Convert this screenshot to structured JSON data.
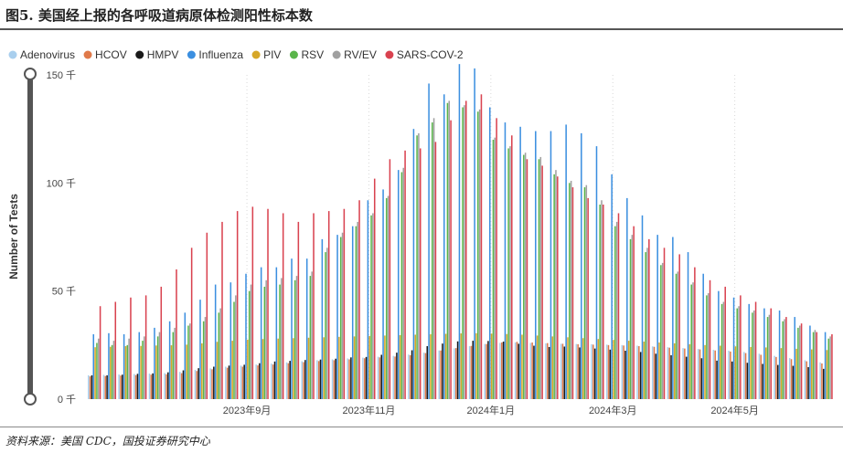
{
  "figure": {
    "title": "图5. 美国经上报的各呼吸道病原体检测阳性标本数",
    "source": "资料来源：美国 CDC，国投证券研究中心"
  },
  "chart_data": {
    "type": "bar",
    "ylabel": "Number of Tests",
    "xlabel": "",
    "ylim": [
      0,
      150000
    ],
    "y_ticks": [
      0,
      50000,
      100000,
      150000
    ],
    "y_tick_labels": [
      "0 千",
      "50 千",
      "100 千",
      "150 千"
    ],
    "x_tick_labels": [
      "2023年9月",
      "2023年11月",
      "2024年1月",
      "2024年3月",
      "2024年5月"
    ],
    "x_tick_category_index": [
      10,
      18,
      26,
      34,
      42
    ],
    "grid": "vertical dotted",
    "legend_position": "top-left",
    "categories_note": "weekly periods, unlabeled",
    "categories": [
      "W01",
      "W02",
      "W03",
      "W04",
      "W05",
      "W06",
      "W07",
      "W08",
      "W09",
      "W10",
      "W11",
      "W12",
      "W13",
      "W14",
      "W15",
      "W16",
      "W17",
      "W18",
      "W19",
      "W20",
      "W21",
      "W22",
      "W23",
      "W24",
      "W25",
      "W26",
      "W27",
      "W28",
      "W29",
      "W30",
      "W31",
      "W32",
      "W33",
      "W34",
      "W35",
      "W36",
      "W37",
      "W38",
      "W39",
      "W40",
      "W41",
      "W42",
      "W43",
      "W44",
      "W45",
      "W46",
      "W47",
      "W48",
      "W49"
    ],
    "series": [
      {
        "name": "Adenovirus",
        "color": "#a9cfee",
        "values": [
          11000,
          11200,
          11400,
          11600,
          11800,
          12000,
          12600,
          13500,
          14200,
          15000,
          15500,
          16000,
          16400,
          17000,
          17500,
          18000,
          18400,
          18800,
          19200,
          19600,
          20000,
          20600,
          21500,
          22500,
          23500,
          24500,
          25500,
          26000,
          26200,
          26000,
          25800,
          25600,
          25500,
          25400,
          25200,
          25000,
          24700,
          24400,
          24000,
          23600,
          23200,
          22800,
          22400,
          21800,
          21000,
          20000,
          19000,
          18000,
          17000
        ]
      },
      {
        "name": "HCOV",
        "color": "#e07a4a",
        "values": [
          10500,
          10700,
          10900,
          11100,
          11300,
          11500,
          12000,
          13000,
          13800,
          14500,
          15000,
          15600,
          16000,
          16600,
          17100,
          17600,
          18000,
          18400,
          18900,
          19300,
          19700,
          20300,
          21300,
          22500,
          23600,
          24600,
          25500,
          26200,
          26500,
          26200,
          25900,
          25600,
          25400,
          25200,
          25000,
          24800,
          24500,
          24200,
          23800,
          23400,
          23000,
          22500,
          22000,
          21300,
          20500,
          19500,
          18500,
          17500,
          16500
        ]
      },
      {
        "name": "HMPV",
        "color": "#1a1a1a",
        "values": [
          11000,
          11000,
          11300,
          11700,
          11900,
          12400,
          13300,
          14300,
          15000,
          15500,
          15900,
          16600,
          17400,
          17700,
          18100,
          18300,
          18700,
          19300,
          19500,
          20500,
          21500,
          22600,
          24500,
          25700,
          26700,
          27000,
          26900,
          26600,
          25600,
          24700,
          24100,
          24300,
          23900,
          23400,
          22900,
          22400,
          21800,
          21000,
          20300,
          19600,
          18900,
          17800,
          17400,
          16800,
          16300,
          15800,
          15400,
          14800,
          14000
        ]
      },
      {
        "name": "Influenza",
        "color": "#3b8fe0",
        "values": [
          30000,
          30500,
          30000,
          31000,
          33000,
          36000,
          40000,
          46000,
          53000,
          54000,
          58000,
          61000,
          61000,
          65000,
          65000,
          74000,
          76000,
          80000,
          92000,
          97000,
          106000,
          125000,
          146000,
          141000,
          155000,
          153000,
          135000,
          128000,
          126000,
          124000,
          124000,
          127000,
          123000,
          117000,
          104000,
          93000,
          85000,
          76000,
          75000,
          68000,
          58000,
          50000,
          47000,
          44000,
          42000,
          41000,
          38000,
          34000,
          31000
        ]
      },
      {
        "name": "PIV",
        "color": "#d6a728",
        "values": [
          24000,
          24200,
          24500,
          24600,
          24800,
          24900,
          25200,
          25800,
          26500,
          27000,
          27500,
          27800,
          28000,
          28200,
          28400,
          28600,
          28800,
          29000,
          29200,
          29400,
          29600,
          29800,
          30000,
          30200,
          30400,
          30500,
          30300,
          30100,
          29800,
          29400,
          29000,
          28600,
          28200,
          27800,
          27400,
          27000,
          26600,
          26200,
          25800,
          25400,
          25000,
          24700,
          24400,
          24100,
          23900,
          23600,
          23300,
          23000,
          22700
        ]
      },
      {
        "name": "RSV",
        "color": "#5ab54b",
        "values": [
          26000,
          25000,
          25000,
          27000,
          29000,
          31000,
          34000,
          36000,
          40000,
          45000,
          50000,
          52000,
          53000,
          55000,
          57000,
          68000,
          75000,
          80000,
          85000,
          93000,
          105000,
          122000,
          128000,
          137000,
          135000,
          133000,
          120000,
          116000,
          113000,
          111000,
          104000,
          100000,
          98000,
          90000,
          80000,
          74000,
          68000,
          62000,
          58000,
          53000,
          48000,
          44000,
          42000,
          40000,
          38000,
          36000,
          33000,
          31000,
          28000
        ]
      },
      {
        "name": "RV/EV",
        "color": "#a0a0a0",
        "values": [
          28000,
          27000,
          28000,
          29000,
          31000,
          33000,
          35000,
          38000,
          42000,
          48000,
          53000,
          55000,
          56000,
          57000,
          59000,
          70000,
          77000,
          82000,
          86000,
          94000,
          107000,
          123000,
          130000,
          138000,
          136000,
          134000,
          121000,
          117000,
          114000,
          112000,
          106000,
          101000,
          99000,
          92000,
          82000,
          76000,
          70000,
          63000,
          59000,
          54000,
          49000,
          45000,
          43000,
          41000,
          39000,
          37000,
          34000,
          32000,
          29000
        ]
      },
      {
        "name": "SARS-COV-2",
        "color": "#d9424f",
        "values": [
          43000,
          45000,
          47000,
          48000,
          52000,
          60000,
          70000,
          77000,
          82000,
          87000,
          89000,
          88000,
          86000,
          82000,
          86000,
          87000,
          88000,
          92000,
          102000,
          111000,
          115000,
          116000,
          119000,
          129000,
          138000,
          141000,
          130000,
          122000,
          111000,
          108000,
          103000,
          98000,
          93000,
          90000,
          86000,
          80000,
          74000,
          70000,
          67000,
          61000,
          55000,
          52000,
          48000,
          45000,
          42000,
          38000,
          35000,
          31000,
          30000
        ]
      }
    ]
  }
}
